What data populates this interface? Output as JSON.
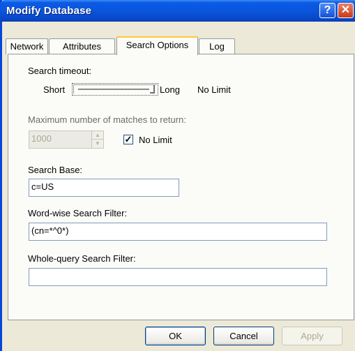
{
  "window": {
    "title": "Modify Database",
    "help_glyph": "?",
    "close_glyph": "✕"
  },
  "tabs": [
    {
      "label": "Network",
      "active": false
    },
    {
      "label": "Attributes",
      "active": false
    },
    {
      "label": "Search Options",
      "active": true
    },
    {
      "label": "Log",
      "active": false
    }
  ],
  "search_timeout": {
    "label": "Search timeout:",
    "min_label": "Short",
    "max_label": "Long",
    "value_text": "No Limit",
    "slider_position": 1.0
  },
  "max_matches": {
    "label": "Maximum number of matches to return:",
    "value": "1000",
    "no_limit_label": "No Limit",
    "no_limit_checked": true,
    "check_glyph": "✓"
  },
  "search_base": {
    "label": "Search Base:",
    "value": "c=US"
  },
  "word_filter": {
    "label": "Word-wise Search Filter:",
    "value": "(cn=*^0*)"
  },
  "query_filter": {
    "label": "Whole-query Search Filter:",
    "value": ""
  },
  "buttons": {
    "ok": "OK",
    "cancel": "Cancel",
    "apply": "Apply"
  },
  "colors": {
    "titlebar": "#0a55dc",
    "dialog_bg": "#ece9d8",
    "active_tab_highlight": "#ffc83c"
  }
}
